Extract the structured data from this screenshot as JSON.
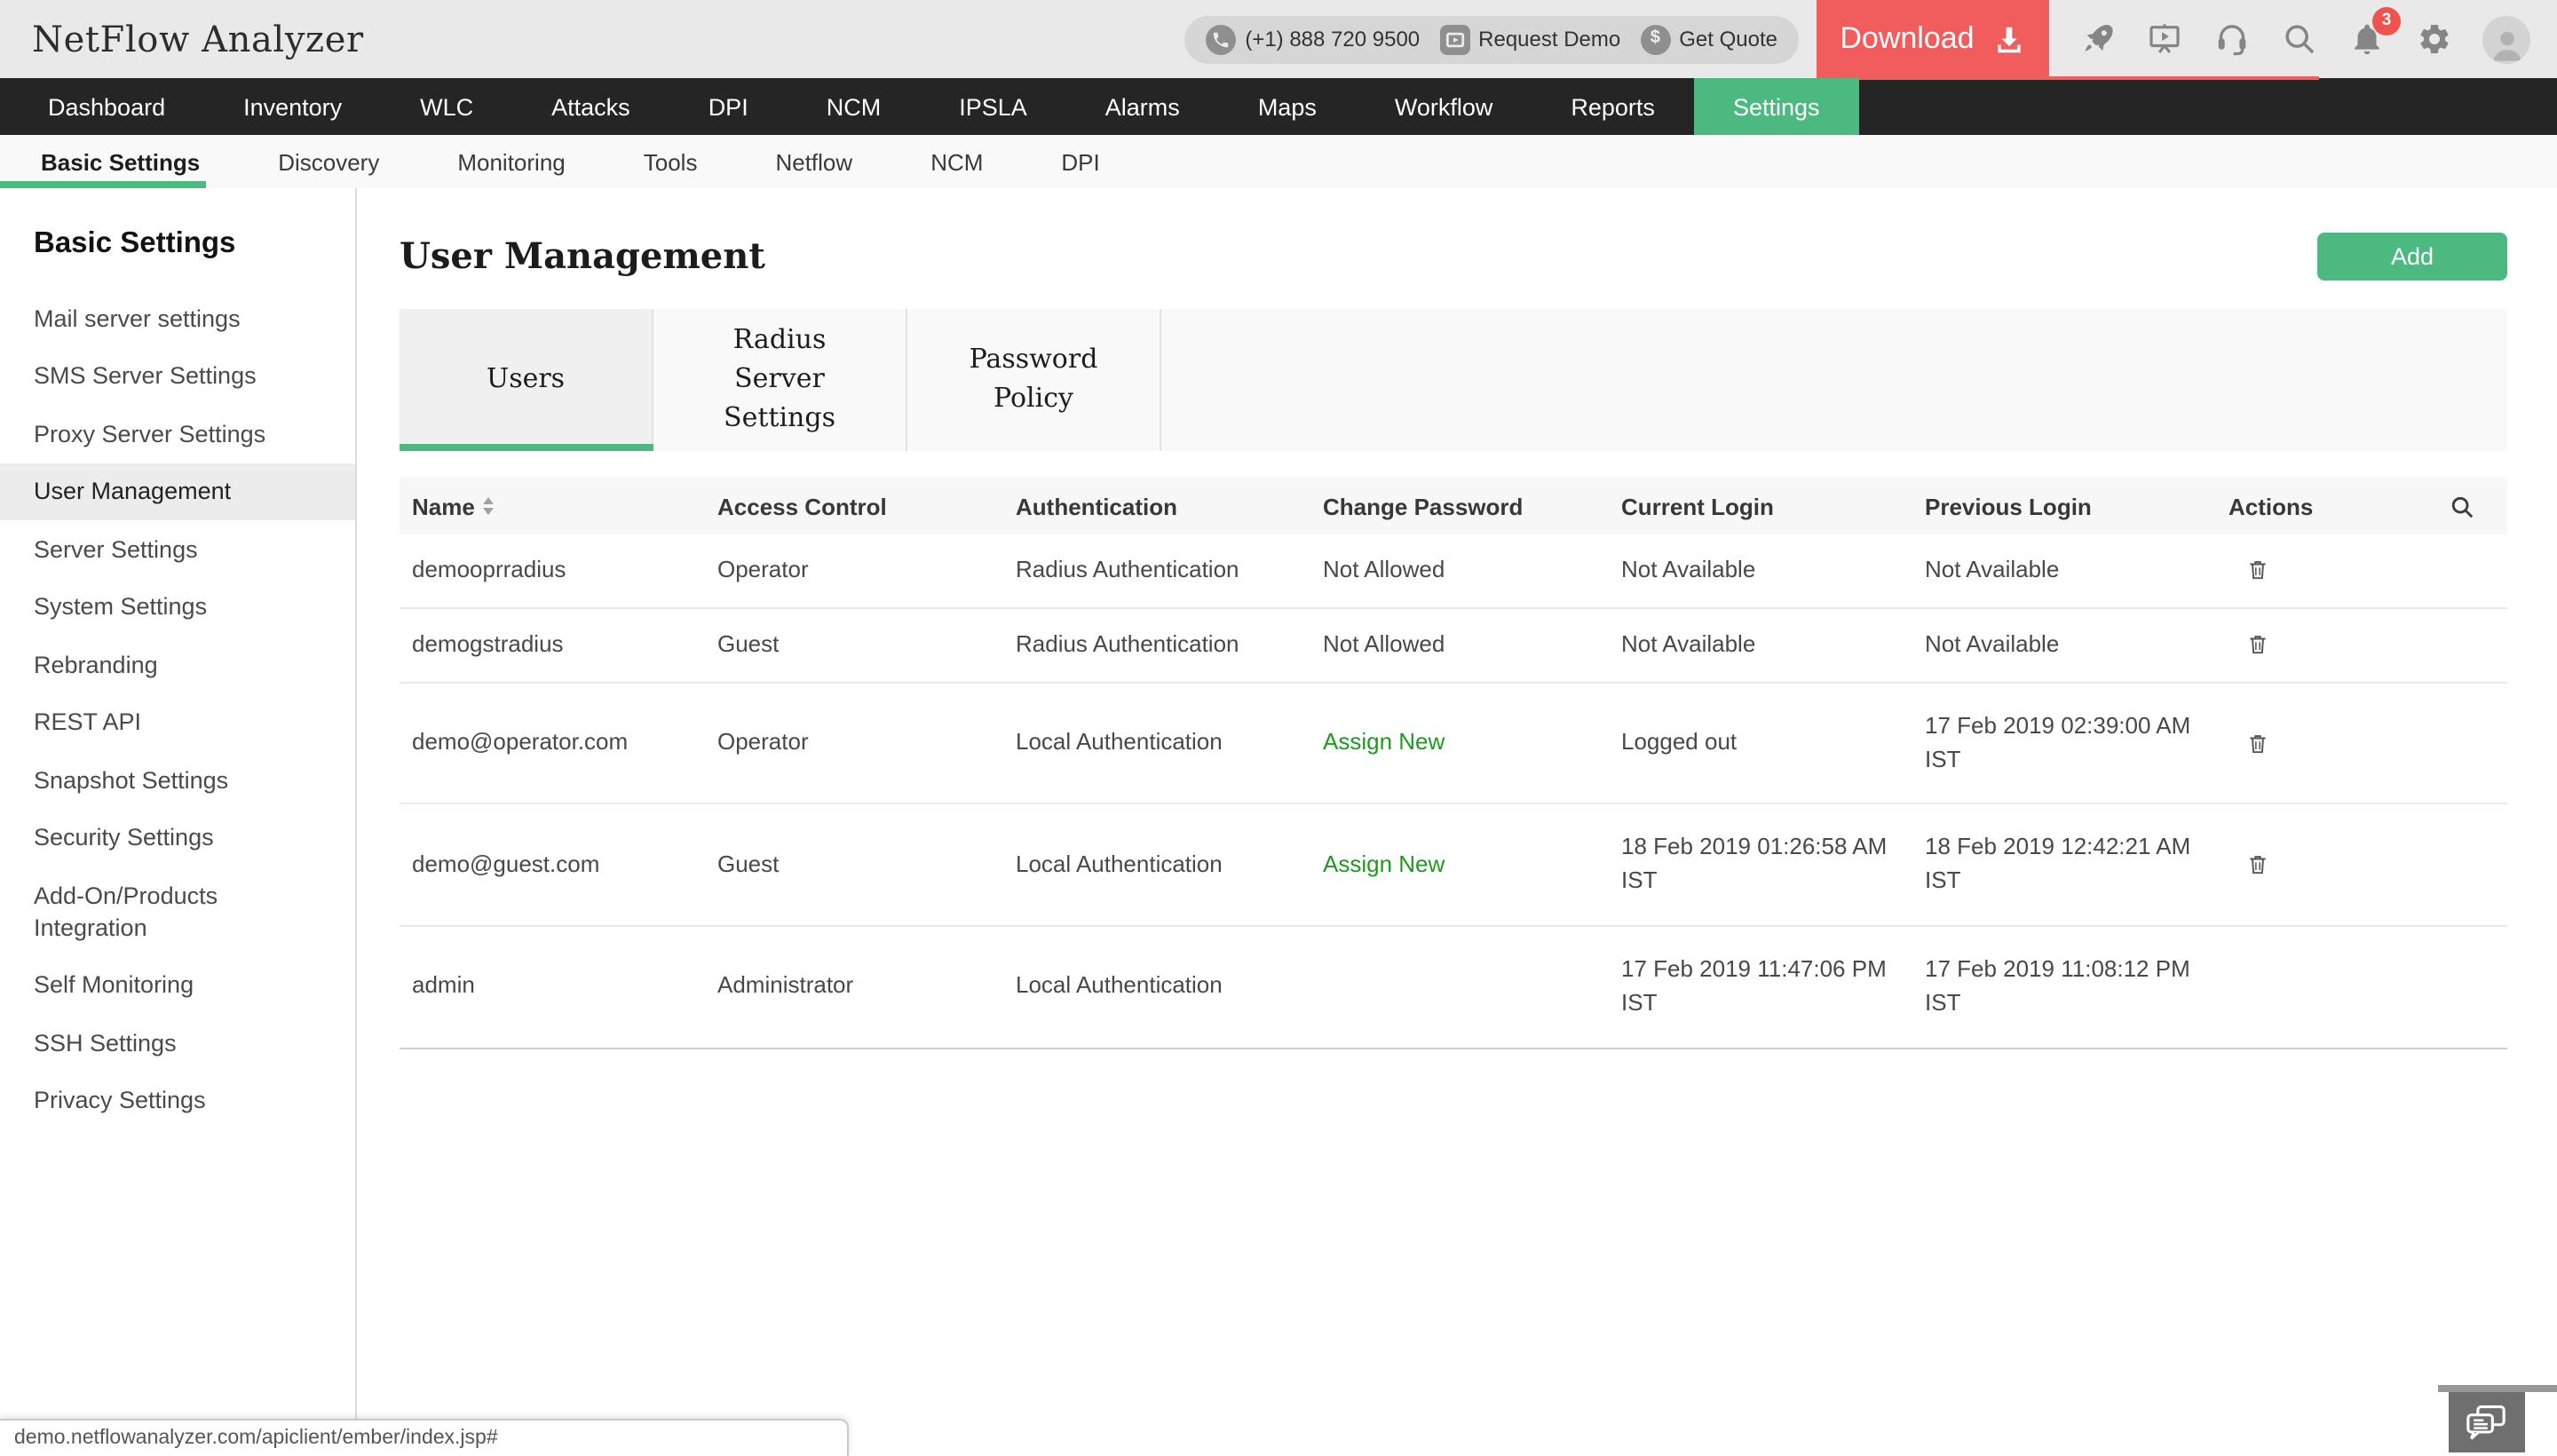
{
  "header": {
    "app_title": "NetFlow Analyzer",
    "phone_number": "(+1) 888 720 9500",
    "request_demo_label": "Request Demo",
    "get_quote_label": "Get Quote",
    "get_quote_icon_char": "$",
    "download_label": "Download",
    "notification_badge": "3"
  },
  "nav": {
    "items": [
      "Dashboard",
      "Inventory",
      "WLC",
      "Attacks",
      "DPI",
      "NCM",
      "IPSLA",
      "Alarms",
      "Maps",
      "Workflow",
      "Reports",
      "Settings"
    ],
    "active": "Settings"
  },
  "subnav": {
    "items": [
      "Basic Settings",
      "Discovery",
      "Monitoring",
      "Tools",
      "Netflow",
      "NCM",
      "DPI"
    ],
    "active": "Basic Settings"
  },
  "sidebar": {
    "title": "Basic Settings",
    "items": [
      "Mail server settings",
      "SMS Server Settings",
      "Proxy Server Settings",
      "User Management",
      "Server Settings",
      "System Settings",
      "Rebranding",
      "REST API",
      "Snapshot Settings",
      "Security Settings",
      "Add-On/Products Integration",
      "Self Monitoring",
      "SSH Settings",
      "Privacy Settings"
    ],
    "selected": "User Management"
  },
  "main": {
    "title": "User Management",
    "add_button_label": "Add",
    "tabs": [
      "Users",
      "Radius Server Settings",
      "Password Policy"
    ],
    "active_tab": "Users",
    "table": {
      "columns": [
        "Name",
        "Access Control",
        "Authentication",
        "Change Password",
        "Current Login",
        "Previous Login",
        "Actions"
      ],
      "rows": [
        {
          "name": "demooprradius",
          "access_control": "Operator",
          "authentication": "Radius Authentication",
          "change_password": "Not Allowed",
          "current_login": "Not Available",
          "previous_login": "Not Available"
        },
        {
          "name": "demogstradius",
          "access_control": "Guest",
          "authentication": "Radius Authentication",
          "change_password": "Not Allowed",
          "current_login": "Not Available",
          "previous_login": "Not Available"
        },
        {
          "name": "demo@operator.com",
          "access_control": "Operator",
          "authentication": "Local Authentication",
          "change_password": "Assign New",
          "current_login": "Logged out",
          "previous_login": "17 Feb 2019 02:39:00 AM IST"
        },
        {
          "name": "demo@guest.com",
          "access_control": "Guest",
          "authentication": "Local Authentication",
          "change_password": "Assign New",
          "current_login": "18 Feb 2019 01:26:58 AM IST",
          "previous_login": "18 Feb 2019 12:42:21 AM IST"
        },
        {
          "name": "admin",
          "access_control": "Administrator",
          "authentication": "Local Authentication",
          "change_password": "",
          "current_login": "17 Feb 2019 11:47:06 PM IST",
          "previous_login": "17 Feb 2019 11:08:12 PM IST"
        }
      ]
    }
  },
  "statusbar": {
    "url": "demo.netflowanalyzer.com/apiclient/ember/index.jsp#"
  },
  "colors": {
    "accent_green": "#4cb981",
    "download_red": "#f15c5c",
    "badge_red": "#ef5350",
    "link_green": "#1d9b1d",
    "nav_dark": "#252525",
    "header_gray": "#e9e9e9"
  }
}
